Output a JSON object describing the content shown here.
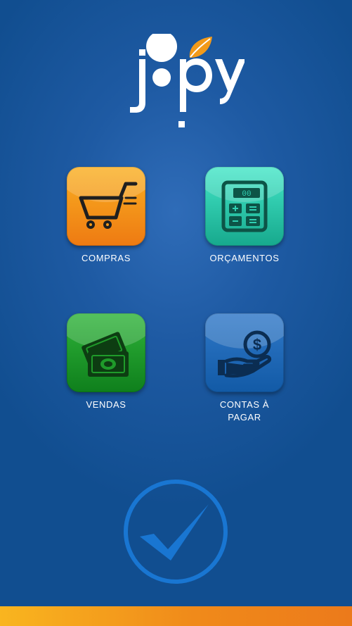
{
  "app": {
    "logo_text": "jopy"
  },
  "menu": {
    "compras": {
      "label": "COMPRAS",
      "icon": "shopping-cart-icon"
    },
    "orcamentos": {
      "label": "ORÇAMENTOS",
      "icon": "calculator-icon"
    },
    "vendas": {
      "label": "VENDAS",
      "icon": "cash-money-icon"
    },
    "contas": {
      "label_line1": "CONTAS À",
      "label_line2": "PAGAR",
      "icon": "hand-dollar-icon"
    }
  },
  "confirm": {
    "icon": "checkmark-icon"
  },
  "colors": {
    "background": "#1e5aa3",
    "compras": "#f39a1a",
    "orcamentos": "#2fcfb2",
    "vendas": "#1f9b2a",
    "contas": "#1f68b8",
    "accent_bar": "#f08a1a",
    "check": "#1976d2"
  }
}
